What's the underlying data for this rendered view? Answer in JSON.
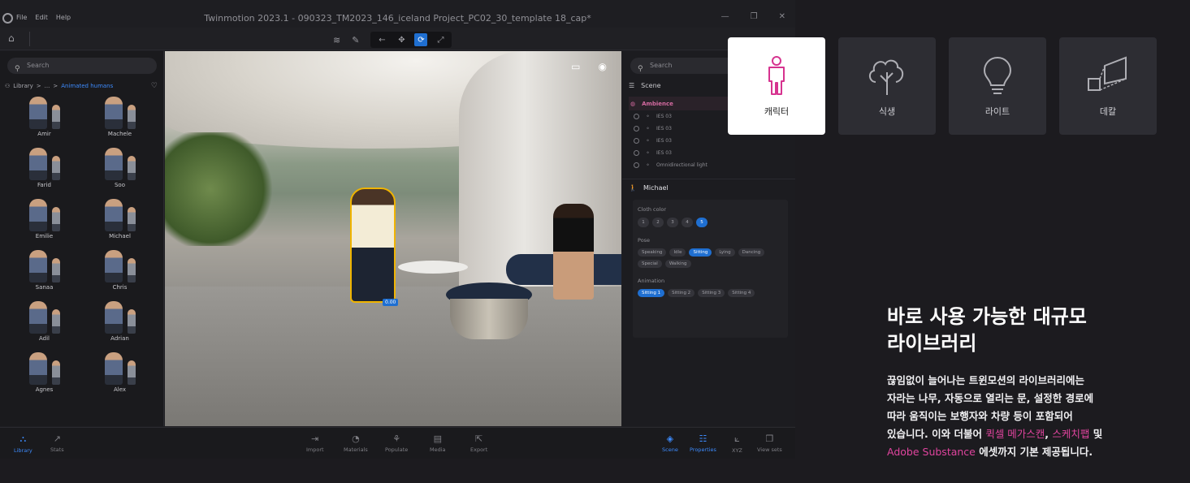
{
  "window": {
    "menu": [
      "File",
      "Edit",
      "Help"
    ],
    "title": "Twinmotion 2023.1 - 090323_TM2023_146_iceland Project_PC02_30_template 18_cap*",
    "controls": [
      "—",
      "❐",
      "✕"
    ]
  },
  "left_panel": {
    "search_placeholder": "Search",
    "breadcrumb": {
      "root": "Library",
      "sep": ">",
      "mid": "...",
      "current": "Animated humans"
    },
    "characters": [
      "Amir",
      "Machele",
      "Farid",
      "Soo",
      "Emilie",
      "Michael",
      "Sanaa",
      "Chris",
      "Adil",
      "Adrian",
      "Agnes",
      "Alex",
      "",
      ""
    ]
  },
  "right_panel": {
    "search_placeholder": "Search",
    "scene_label": "Scene",
    "outline": [
      {
        "label": "Ambience",
        "highlight": true
      },
      {
        "label": "IES 03"
      },
      {
        "label": "IES 03"
      },
      {
        "label": "IES 03"
      },
      {
        "label": "IES 03"
      },
      {
        "label": "Omnidirectional light"
      }
    ],
    "selected_name": "Michael",
    "cloth_color": {
      "title": "Cloth color",
      "options": [
        "1",
        "2",
        "3",
        "4",
        "5"
      ],
      "selected": "5"
    },
    "pose": {
      "title": "Pose",
      "options": [
        "Speaking",
        "Idle",
        "Sitting",
        "Lying",
        "Dancing",
        "Special",
        "Walking"
      ],
      "selected": "Sitting"
    },
    "animation": {
      "title": "Animation",
      "options": [
        "Sitting 1",
        "Sitting 2",
        "Sitting 3",
        "Sitting 4"
      ],
      "selected": "Sitting 1"
    }
  },
  "viewport": {
    "handle_value": "0.00"
  },
  "bottom_bar": {
    "left": [
      {
        "label": "Library",
        "active": true
      },
      {
        "label": "Stats",
        "active": false
      }
    ],
    "center": [
      "Import",
      "Materials",
      "Populate",
      "Media",
      "Export"
    ],
    "right": [
      {
        "label": "Scene",
        "active": true
      },
      {
        "label": "Properties",
        "active": true
      },
      {
        "label": "XYZ",
        "active": false
      },
      {
        "label": "View sets",
        "active": false
      }
    ]
  },
  "categories": [
    {
      "label": "캐릭터",
      "icon": "person-icon",
      "selected": true
    },
    {
      "label": "식생",
      "icon": "tree-icon",
      "selected": false
    },
    {
      "label": "라이트",
      "icon": "lightbulb-icon",
      "selected": false
    },
    {
      "label": "데칼",
      "icon": "decal-icon",
      "selected": false
    }
  ],
  "marketing": {
    "headline_line1": "바로 사용 가능한 대규모",
    "headline_line2": "라이브러리",
    "body_1": "끊임없이 늘어나는 트윈모션의 라이브러리에는",
    "body_2": "자라는 나무, 자동으로 열리는 문, 설정한 경로에",
    "body_3": "따라 움직이는 보행자와 차량 등이 포함되어",
    "body_4a": "있습니다. 이와 더불어 ",
    "link_megascans": "퀵셀 메가스캔",
    "body_4b": ", ",
    "link_sketchfab": "스케치팹",
    "body_4c": " 및",
    "link_substance": "Adobe Substance",
    "body_5": " 에셋까지 기본 제공됩니다."
  },
  "colors": {
    "accent_pink": "#e0449e",
    "accent_blue": "#1f6fd1",
    "background": "#1c1b1f"
  }
}
